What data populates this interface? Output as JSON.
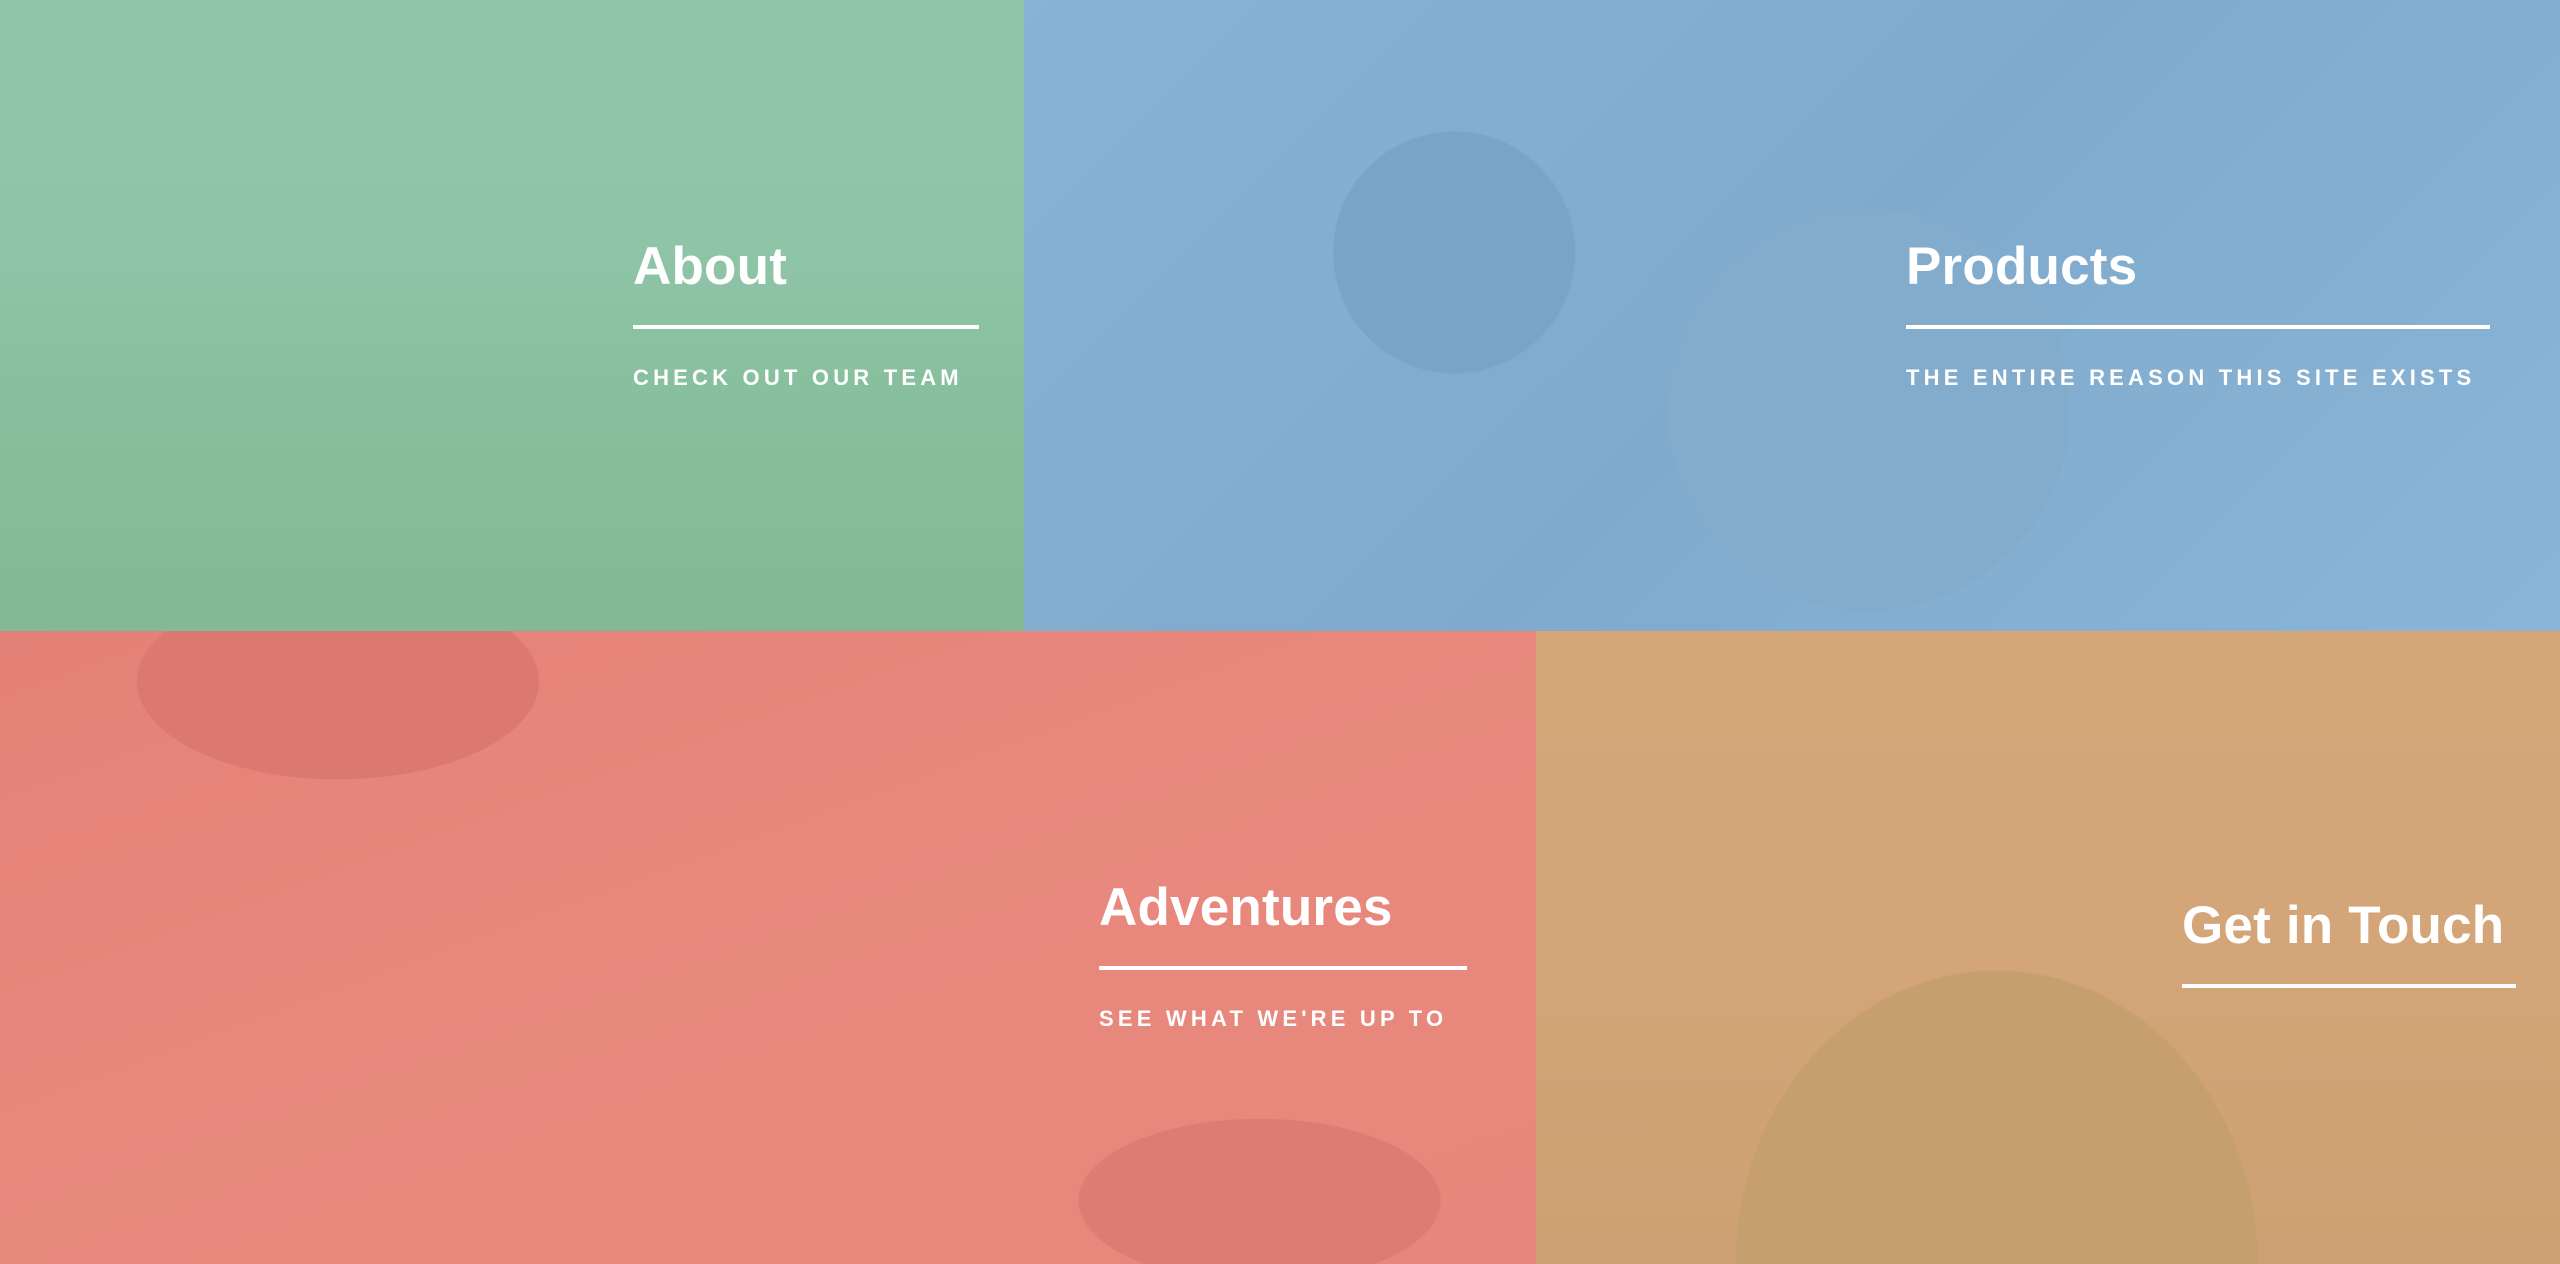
{
  "tiles": [
    {
      "id": "about",
      "title": "About",
      "subtitle": "CHECK OUT OUR TEAM",
      "overlay_color": "#8bc4a6"
    },
    {
      "id": "products",
      "title": "Products",
      "subtitle": "THE ENTIRE REASON THIS SITE EXISTS",
      "overlay_color": "#88b4d6"
    },
    {
      "id": "adventures",
      "title": "Adventures",
      "subtitle": "SEE WHAT WE'RE UP TO",
      "overlay_color": "#e9867c"
    },
    {
      "id": "contact",
      "title": "Get in Touch",
      "subtitle": "",
      "overlay_color": "#d6a678"
    }
  ]
}
